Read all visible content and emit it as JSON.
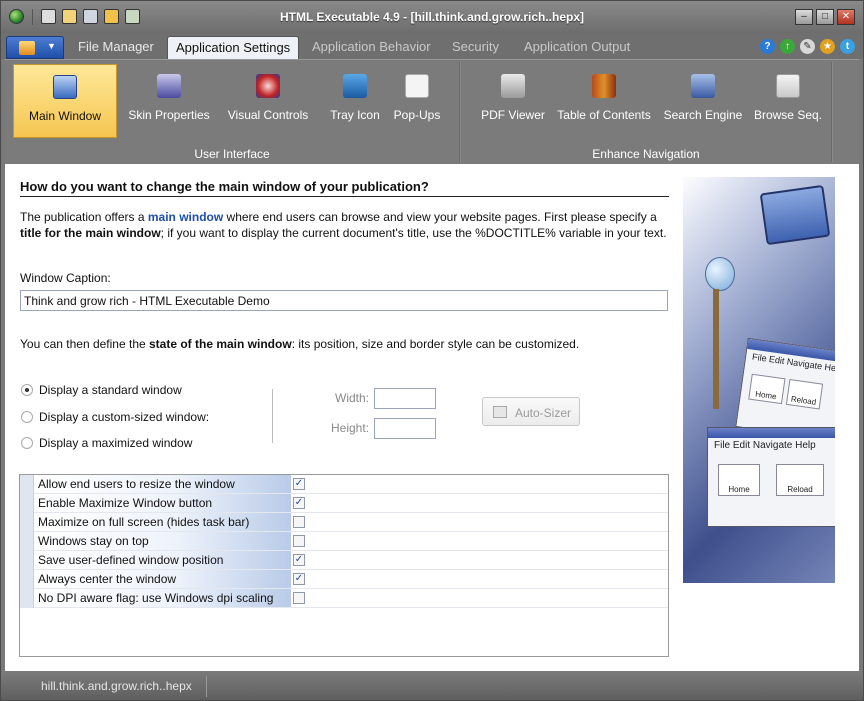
{
  "window": {
    "title": "HTML Executable 4.9 - [hill.think.and.grow.rich..hepx]",
    "buttons": [
      "minimize",
      "maximize",
      "close"
    ]
  },
  "quick_access": [
    "app-globe-icon",
    "new-file-icon",
    "open-file-icon",
    "save-icon",
    "build-icon",
    "settings-icon"
  ],
  "tabs": [
    {
      "label": "File Manager",
      "active": false,
      "enabled": true
    },
    {
      "label": "Application Settings",
      "active": true,
      "enabled": true
    },
    {
      "label": "Application Behavior",
      "active": false,
      "enabled": false
    },
    {
      "label": "Security",
      "active": false,
      "enabled": false
    },
    {
      "label": "Application Output",
      "active": false,
      "enabled": false
    }
  ],
  "top_icons": [
    "help-icon",
    "update-icon",
    "tools-icon",
    "award-icon",
    "twitter-icon"
  ],
  "ribbon": {
    "groups": [
      {
        "label": "User Interface",
        "buttons": [
          {
            "label": "Main Window",
            "icon": "monitor-icon",
            "active": true
          },
          {
            "label": "Skin Properties",
            "icon": "paint-brush-icon",
            "active": false
          },
          {
            "label": "Visual Controls",
            "icon": "controls-icon",
            "active": false
          },
          {
            "label": "Tray Icon",
            "icon": "tray-icon",
            "active": false
          },
          {
            "label": "Pop-Ups",
            "icon": "popup-icon",
            "active": false
          }
        ]
      },
      {
        "label": "Enhance Navigation",
        "buttons": [
          {
            "label": "PDF Viewer",
            "icon": "pdf-icon",
            "active": false
          },
          {
            "label": "Table of Contents",
            "icon": "books-icon",
            "active": false
          },
          {
            "label": "Search Engine",
            "icon": "search-book-icon",
            "active": false
          },
          {
            "label": "Browse Seq.",
            "icon": "sequence-icon",
            "active": false
          }
        ]
      }
    ]
  },
  "main": {
    "heading": "How do you want to change the main window of your publication?",
    "intro": {
      "part1": "The publication offers a ",
      "link": "main window",
      "part2": " where end users can browse and view your website pages. First please specify a ",
      "bold": "title for the main window",
      "part3": "; if you want to display the current document's title, use the %DOCTITLE% variable in your text."
    },
    "caption_label": "Window Caption:",
    "caption_value": "Think and grow rich - HTML Executable Demo",
    "state_text": {
      "part1": "You can then define the ",
      "bold": "state of the main window",
      "part2": ": its position, size and border style can be customized."
    },
    "radios": [
      {
        "label": "Display a standard window",
        "checked": true
      },
      {
        "label": "Display a custom-sized window:",
        "checked": false
      },
      {
        "label": "Display a maximized window",
        "checked": false
      }
    ],
    "width_label": "Width:",
    "height_label": "Height:",
    "width_value": "",
    "height_value": "",
    "autosizer_label": "Auto-Sizer",
    "options": [
      {
        "label": "Allow end users to resize the window",
        "checked": true
      },
      {
        "label": "Enable Maximize Window button",
        "checked": true
      },
      {
        "label": "Maximize on full screen (hides task bar)",
        "checked": false
      },
      {
        "label": "Windows stay on top",
        "checked": false
      },
      {
        "label": "Save user-defined window position",
        "checked": true
      },
      {
        "label": "Always center the window",
        "checked": true
      },
      {
        "label": "No DPI aware flag: use Windows dpi scaling",
        "checked": false
      }
    ]
  },
  "illustration": {
    "menu_small": "File  Edit  Navigate  Help",
    "menu_large": "File  Edit  Navigate  Help",
    "btn_home": "Home",
    "btn_reload": "Reload"
  },
  "statusbar": {
    "project": "hill.think.and.grow.rich..hepx"
  },
  "colors": {
    "accent": "#1f4fa8",
    "active_ribbon": "#f5c650",
    "chrome": "#7a7a7a"
  }
}
